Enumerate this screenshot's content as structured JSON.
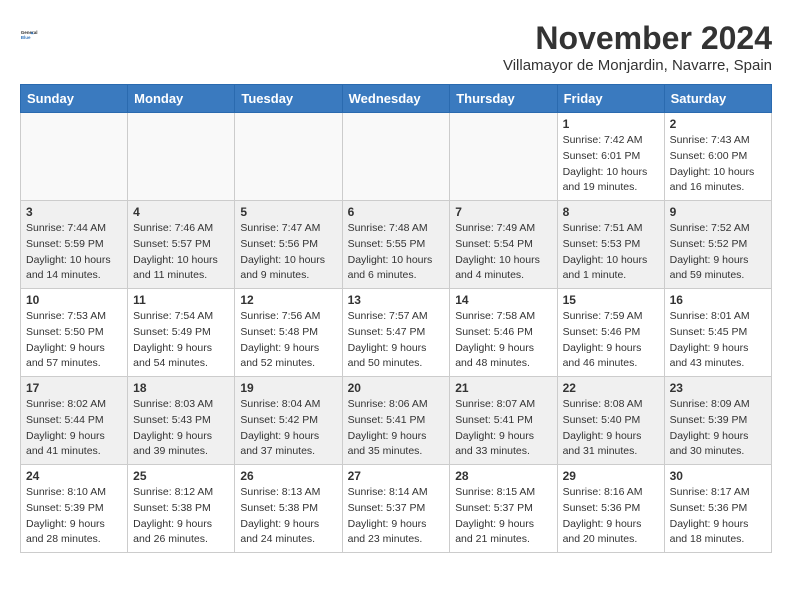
{
  "header": {
    "logo_general": "General",
    "logo_blue": "Blue",
    "month_year": "November 2024",
    "location": "Villamayor de Monjardin, Navarre, Spain"
  },
  "weekdays": [
    "Sunday",
    "Monday",
    "Tuesday",
    "Wednesday",
    "Thursday",
    "Friday",
    "Saturday"
  ],
  "weeks": [
    [
      {
        "day": "",
        "info": ""
      },
      {
        "day": "",
        "info": ""
      },
      {
        "day": "",
        "info": ""
      },
      {
        "day": "",
        "info": ""
      },
      {
        "day": "",
        "info": ""
      },
      {
        "day": "1",
        "info": "Sunrise: 7:42 AM\nSunset: 6:01 PM\nDaylight: 10 hours and 19 minutes."
      },
      {
        "day": "2",
        "info": "Sunrise: 7:43 AM\nSunset: 6:00 PM\nDaylight: 10 hours and 16 minutes."
      }
    ],
    [
      {
        "day": "3",
        "info": "Sunrise: 7:44 AM\nSunset: 5:59 PM\nDaylight: 10 hours and 14 minutes."
      },
      {
        "day": "4",
        "info": "Sunrise: 7:46 AM\nSunset: 5:57 PM\nDaylight: 10 hours and 11 minutes."
      },
      {
        "day": "5",
        "info": "Sunrise: 7:47 AM\nSunset: 5:56 PM\nDaylight: 10 hours and 9 minutes."
      },
      {
        "day": "6",
        "info": "Sunrise: 7:48 AM\nSunset: 5:55 PM\nDaylight: 10 hours and 6 minutes."
      },
      {
        "day": "7",
        "info": "Sunrise: 7:49 AM\nSunset: 5:54 PM\nDaylight: 10 hours and 4 minutes."
      },
      {
        "day": "8",
        "info": "Sunrise: 7:51 AM\nSunset: 5:53 PM\nDaylight: 10 hours and 1 minute."
      },
      {
        "day": "9",
        "info": "Sunrise: 7:52 AM\nSunset: 5:52 PM\nDaylight: 9 hours and 59 minutes."
      }
    ],
    [
      {
        "day": "10",
        "info": "Sunrise: 7:53 AM\nSunset: 5:50 PM\nDaylight: 9 hours and 57 minutes."
      },
      {
        "day": "11",
        "info": "Sunrise: 7:54 AM\nSunset: 5:49 PM\nDaylight: 9 hours and 54 minutes."
      },
      {
        "day": "12",
        "info": "Sunrise: 7:56 AM\nSunset: 5:48 PM\nDaylight: 9 hours and 52 minutes."
      },
      {
        "day": "13",
        "info": "Sunrise: 7:57 AM\nSunset: 5:47 PM\nDaylight: 9 hours and 50 minutes."
      },
      {
        "day": "14",
        "info": "Sunrise: 7:58 AM\nSunset: 5:46 PM\nDaylight: 9 hours and 48 minutes."
      },
      {
        "day": "15",
        "info": "Sunrise: 7:59 AM\nSunset: 5:46 PM\nDaylight: 9 hours and 46 minutes."
      },
      {
        "day": "16",
        "info": "Sunrise: 8:01 AM\nSunset: 5:45 PM\nDaylight: 9 hours and 43 minutes."
      }
    ],
    [
      {
        "day": "17",
        "info": "Sunrise: 8:02 AM\nSunset: 5:44 PM\nDaylight: 9 hours and 41 minutes."
      },
      {
        "day": "18",
        "info": "Sunrise: 8:03 AM\nSunset: 5:43 PM\nDaylight: 9 hours and 39 minutes."
      },
      {
        "day": "19",
        "info": "Sunrise: 8:04 AM\nSunset: 5:42 PM\nDaylight: 9 hours and 37 minutes."
      },
      {
        "day": "20",
        "info": "Sunrise: 8:06 AM\nSunset: 5:41 PM\nDaylight: 9 hours and 35 minutes."
      },
      {
        "day": "21",
        "info": "Sunrise: 8:07 AM\nSunset: 5:41 PM\nDaylight: 9 hours and 33 minutes."
      },
      {
        "day": "22",
        "info": "Sunrise: 8:08 AM\nSunset: 5:40 PM\nDaylight: 9 hours and 31 minutes."
      },
      {
        "day": "23",
        "info": "Sunrise: 8:09 AM\nSunset: 5:39 PM\nDaylight: 9 hours and 30 minutes."
      }
    ],
    [
      {
        "day": "24",
        "info": "Sunrise: 8:10 AM\nSunset: 5:39 PM\nDaylight: 9 hours and 28 minutes."
      },
      {
        "day": "25",
        "info": "Sunrise: 8:12 AM\nSunset: 5:38 PM\nDaylight: 9 hours and 26 minutes."
      },
      {
        "day": "26",
        "info": "Sunrise: 8:13 AM\nSunset: 5:38 PM\nDaylight: 9 hours and 24 minutes."
      },
      {
        "day": "27",
        "info": "Sunrise: 8:14 AM\nSunset: 5:37 PM\nDaylight: 9 hours and 23 minutes."
      },
      {
        "day": "28",
        "info": "Sunrise: 8:15 AM\nSunset: 5:37 PM\nDaylight: 9 hours and 21 minutes."
      },
      {
        "day": "29",
        "info": "Sunrise: 8:16 AM\nSunset: 5:36 PM\nDaylight: 9 hours and 20 minutes."
      },
      {
        "day": "30",
        "info": "Sunrise: 8:17 AM\nSunset: 5:36 PM\nDaylight: 9 hours and 18 minutes."
      }
    ]
  ]
}
